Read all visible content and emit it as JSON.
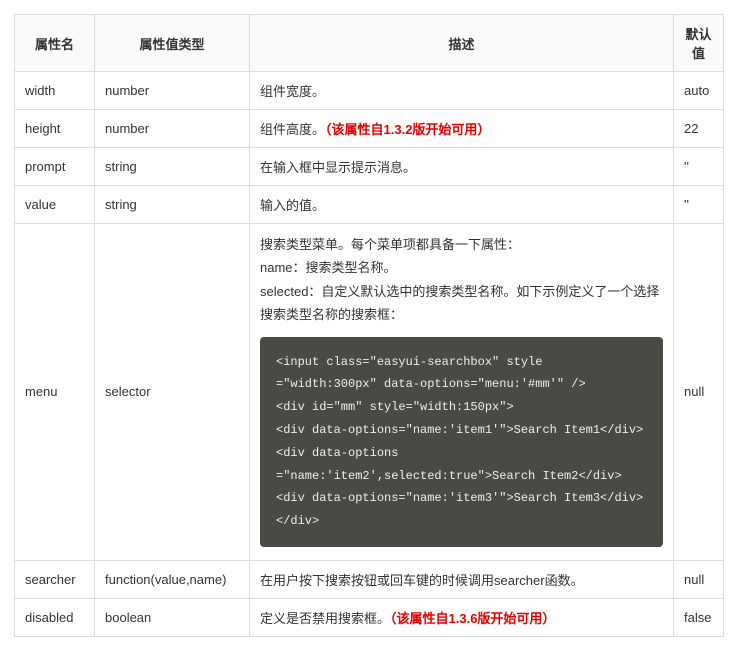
{
  "headers": {
    "name": "属性名",
    "type": "属性值类型",
    "desc": "描述",
    "def": "默认值"
  },
  "rows": [
    {
      "name": "width",
      "type": "number",
      "desc": "组件宽度。",
      "note": "",
      "def": "auto"
    },
    {
      "name": "height",
      "type": "number",
      "desc": "组件高度。",
      "note": "（该属性自1.3.2版开始可用）",
      "def": "22"
    },
    {
      "name": "prompt",
      "type": "string",
      "desc": "在输入框中显示提示消息。",
      "note": "",
      "def": "''"
    },
    {
      "name": "value",
      "type": "string",
      "desc": "输入的值。",
      "note": "",
      "def": "''"
    }
  ],
  "menu_row": {
    "name": "menu",
    "type": "selector",
    "desc_before_code": "搜索类型菜单。每个菜单项都具备一下属性：\nname：搜索类型名称。\nselected：自定义默认选中的搜索类型名称。如下示例定义了一个选择搜索类型名称的搜索框：",
    "code": "<input class=\"easyui-searchbox\" style\n=\"width:300px\" data-options=\"menu:'#mm'\" />\n<div id=\"mm\" style=\"width:150px\">\n<div data-options=\"name:'item1'\">Search Item1</div>\n<div data-options\n=\"name:'item2',selected:true\">Search Item2</div>\n<div data-options=\"name:'item3'\">Search Item3</div>\n</div>",
    "def": "null"
  },
  "rows_after": [
    {
      "name": "searcher",
      "type": "function(value,name)",
      "desc": "在用户按下搜索按钮或回车键的时候调用searcher函数。",
      "note": "",
      "def": "null"
    },
    {
      "name": "disabled",
      "type": "boolean",
      "desc": "定义是否禁用搜索框。",
      "note": "（该属性自1.3.6版开始可用）",
      "def": "false"
    }
  ]
}
